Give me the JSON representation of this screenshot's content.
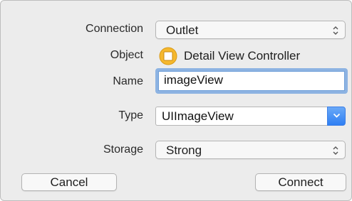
{
  "dialog": {
    "connection": {
      "label": "Connection",
      "value": "Outlet"
    },
    "object": {
      "label": "Object",
      "value": "Detail View Controller",
      "icon": "view-controller-icon",
      "icon_color": "#f5b82e"
    },
    "name": {
      "label": "Name",
      "value": "imageView"
    },
    "type": {
      "label": "Type",
      "value": "UIImageView"
    },
    "storage": {
      "label": "Storage",
      "value": "Strong"
    },
    "buttons": {
      "cancel": "Cancel",
      "connect": "Connect"
    }
  },
  "colors": {
    "accent": "#2f7ff3",
    "focus_ring": "#8db3e2",
    "background": "#ececec"
  }
}
